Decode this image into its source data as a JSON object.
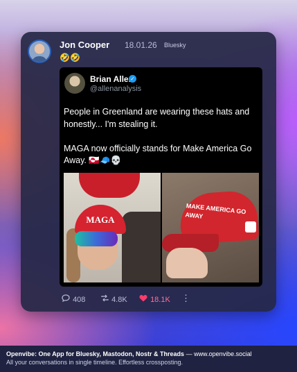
{
  "post": {
    "author": "Jon Cooper",
    "date": "18.01.26",
    "network": "Bluesky",
    "text": "🤣🤣"
  },
  "quote": {
    "name": "Brian Allen",
    "handle": "@allenanalysis",
    "text": "People in Greenland are wearing these hats and honestly... I'm stealing it.\n\nMAGA now officially stands for Make America Go Away. 🇬🇱🧢💀",
    "images": {
      "left_hat_text": "MAGA",
      "right_hat_text": "MAKE AMERICA GO AWAY"
    }
  },
  "stats": {
    "replies": "408",
    "reposts": "4.8K",
    "likes": "18.1K",
    "more": "⋮"
  },
  "icons": {
    "reply": "speech-bubble-icon",
    "repost": "repost-icon",
    "like": "heart-icon",
    "more": "more-vertical-icon",
    "verified": "verified-badge-icon"
  },
  "colors": {
    "like": "#ff3b6b",
    "verified": "#1d9bf0",
    "card": "#262846"
  },
  "footer": {
    "brand": "Openvibe: One App for Bluesky, Mastodon, Nostr & Threads",
    "url": "— www.openvibe.social",
    "tagline": "All your conversations in single timeline. Effortless crossposting."
  }
}
